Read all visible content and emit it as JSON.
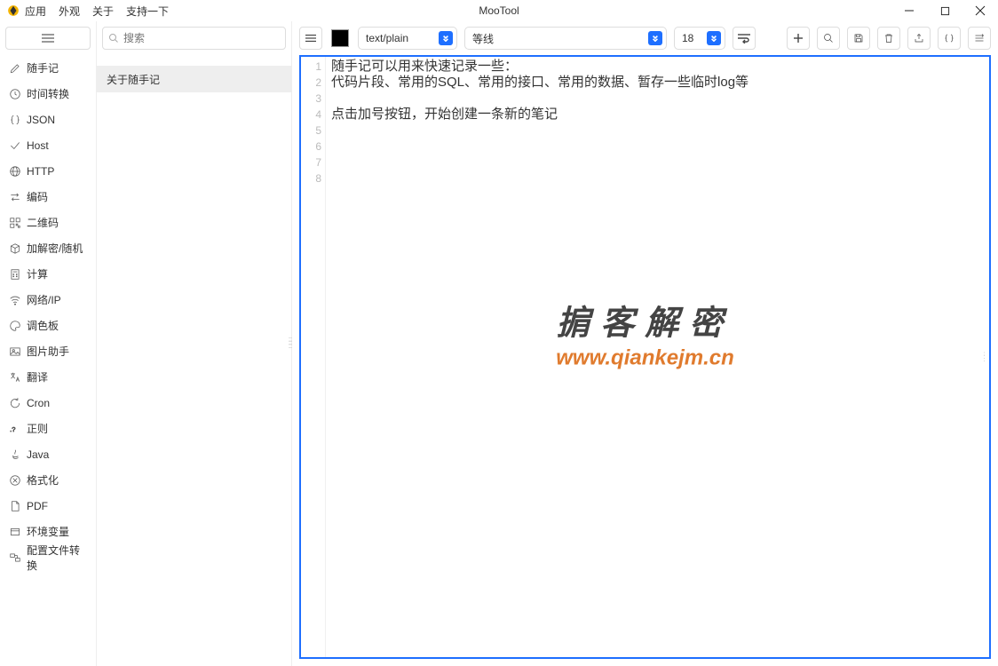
{
  "app": {
    "title": "MooTool"
  },
  "menu": [
    "应用",
    "外观",
    "关于",
    "支持一下"
  ],
  "sidebar": {
    "items": [
      {
        "label": "随手记",
        "icon": "edit"
      },
      {
        "label": "时间转换",
        "icon": "clock"
      },
      {
        "label": "JSON",
        "icon": "braces"
      },
      {
        "label": "Host",
        "icon": "check"
      },
      {
        "label": "HTTP",
        "icon": "globe"
      },
      {
        "label": "编码",
        "icon": "swap"
      },
      {
        "label": "二维码",
        "icon": "qrcode"
      },
      {
        "label": "加解密/随机",
        "icon": "cube"
      },
      {
        "label": "计算",
        "icon": "calc"
      },
      {
        "label": "网络/IP",
        "icon": "wifi"
      },
      {
        "label": "调色板",
        "icon": "palette"
      },
      {
        "label": "图片助手",
        "icon": "image"
      },
      {
        "label": "翻译",
        "icon": "translate"
      },
      {
        "label": "Cron",
        "icon": "refresh"
      },
      {
        "label": "正则",
        "icon": "regex"
      },
      {
        "label": "Java",
        "icon": "java"
      },
      {
        "label": "格式化",
        "icon": "format"
      },
      {
        "label": "PDF",
        "icon": "pdf"
      },
      {
        "label": "环境变量",
        "icon": "env"
      },
      {
        "label": "配置文件转换",
        "icon": "config"
      }
    ]
  },
  "search": {
    "placeholder": "搜索"
  },
  "notes": {
    "items": [
      {
        "title": "关于随手记",
        "active": true
      }
    ]
  },
  "controls": {
    "type_value": "text/plain",
    "font_value": "等线",
    "size_value": "18"
  },
  "editor": {
    "lines": [
      "随手记可以用来快速记录一些：",
      "代码片段、常用的SQL、常用的接口、常用的数据、暂存一些临时log等",
      "",
      "点击加号按钮，开始创建一条新的笔记",
      "",
      "",
      "",
      ""
    ]
  },
  "watermark": {
    "line1": "掮客解密",
    "line2": "www.qiankejm.cn"
  }
}
